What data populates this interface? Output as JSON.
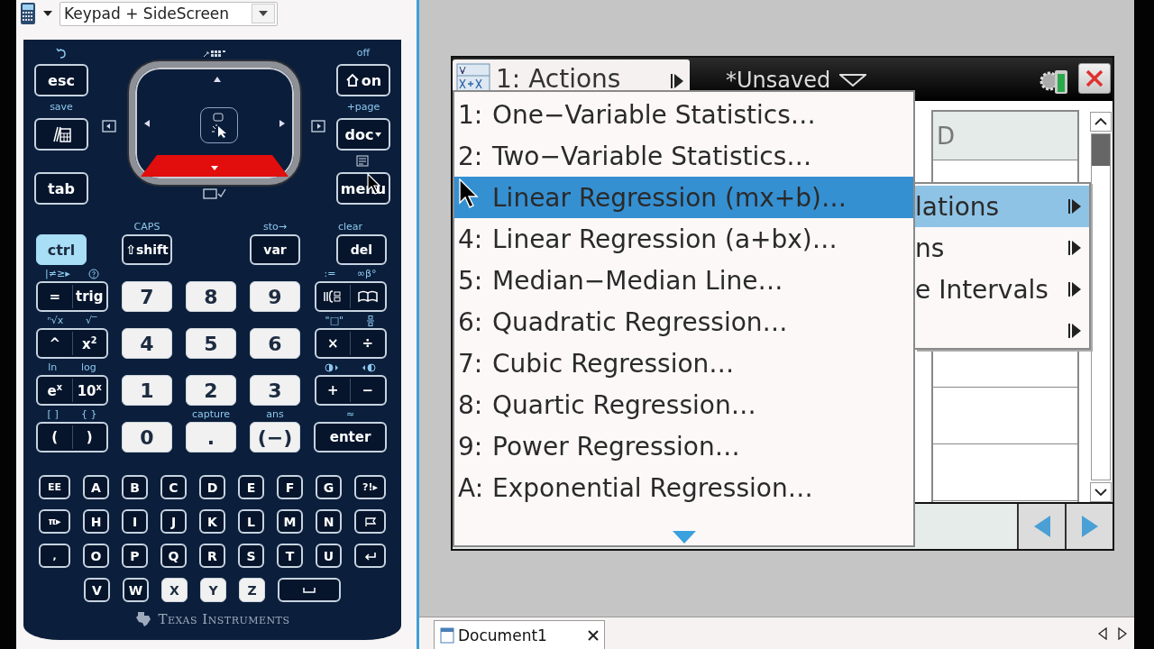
{
  "toolbar": {
    "view": "Keypad + SideScreen"
  },
  "keypad": {
    "left_keys": [
      {
        "kind": "text",
        "label": "esc"
      },
      {
        "kind": "scratchpad",
        "above": "save"
      },
      {
        "kind": "text",
        "label": "tab"
      }
    ],
    "right_keys": [
      {
        "kind": "home",
        "label": "on",
        "above": "off"
      },
      {
        "kind": "dropdown",
        "label": "doc",
        "above": "+page"
      },
      {
        "kind": "text",
        "label": "menu"
      }
    ],
    "top_row": [
      {
        "label": "ctrl",
        "on": true
      },
      {
        "label": "⇧shift",
        "above": "CAPS",
        "on": false
      },
      {
        "label": "var",
        "above": "sto→",
        "on": false
      },
      {
        "label": "del",
        "above": "clear",
        "on": false
      }
    ],
    "rows": [
      [
        {
          "kind": "pair",
          "keys": [
            {
              "kind": "text",
              "label": "=",
              "above": "|≠≥▸"
            },
            {
              "kind": "text",
              "label": "trig",
              "above": {
                "kind": "help"
              }
            }
          ]
        },
        {
          "kind": "light",
          "label": "7"
        },
        {
          "kind": "light",
          "label": "8"
        },
        {
          "kind": "light",
          "label": "9"
        },
        {
          "kind": "pair",
          "keys": [
            {
              "kind": "template",
              "above": ":="
            },
            {
              "kind": "catalog",
              "above": "∞β°"
            }
          ]
        }
      ],
      [
        {
          "kind": "pair",
          "keys": [
            {
              "kind": "text",
              "label": "^",
              "above": "ⁿ√x"
            },
            {
              "kind": "text",
              "label": "x$^{2}$",
              "above": "√‾"
            }
          ]
        },
        {
          "kind": "light",
          "label": "4"
        },
        {
          "kind": "light",
          "label": "5"
        },
        {
          "kind": "light",
          "label": "6"
        },
        {
          "kind": "pair",
          "keys": [
            {
              "kind": "text",
              "label": "×",
              "above": "\"□\""
            },
            {
              "kind": "text",
              "label": "÷",
              "above": {
                "kind": "fraction"
              }
            }
          ]
        }
      ],
      [
        {
          "kind": "pair",
          "keys": [
            {
              "kind": "text",
              "label": "e$^{x}$",
              "above": "ln"
            },
            {
              "kind": "text",
              "label": "10$^{x}$",
              "above": "log"
            }
          ]
        },
        {
          "kind": "light",
          "label": "1"
        },
        {
          "kind": "light",
          "label": "2"
        },
        {
          "kind": "light",
          "label": "3"
        },
        {
          "kind": "pair",
          "keys": [
            {
              "kind": "text",
              "label": "+",
              "above": {
                "kind": "contrast-left"
              }
            },
            {
              "kind": "text",
              "label": "−",
              "above": {
                "kind": "contrast-right"
              }
            }
          ]
        }
      ],
      [
        {
          "kind": "pair",
          "keys": [
            {
              "kind": "text",
              "label": "(",
              "above": "[ ]"
            },
            {
              "kind": "text",
              "label": ")",
              "above": "{ }"
            }
          ]
        },
        {
          "kind": "light",
          "label": "0"
        },
        {
          "kind": "light",
          "label": ".",
          "above": "capture"
        },
        {
          "kind": "light",
          "label": "(−)",
          "above": "ans"
        },
        {
          "kind": "dark",
          "label": "enter",
          "above": "≈"
        }
      ]
    ],
    "letters": [
      [
        {
          "kind": "function",
          "label": "EE"
        },
        {
          "kind": "dark",
          "label": "A"
        },
        {
          "kind": "dark",
          "label": "B"
        },
        {
          "kind": "dark",
          "label": "C"
        },
        {
          "kind": "dark",
          "label": "D"
        },
        {
          "kind": "dark",
          "label": "E"
        },
        {
          "kind": "dark",
          "label": "F"
        },
        {
          "kind": "dark",
          "label": "G"
        },
        {
          "kind": "function",
          "label": "?!▸"
        }
      ],
      [
        {
          "kind": "function",
          "label": "π▸"
        },
        {
          "kind": "dark",
          "label": "H"
        },
        {
          "kind": "dark",
          "label": "I"
        },
        {
          "kind": "dark",
          "label": "J"
        },
        {
          "kind": "dark",
          "label": "K"
        },
        {
          "kind": "dark",
          "label": "L"
        },
        {
          "kind": "dark",
          "label": "M"
        },
        {
          "kind": "dark",
          "label": "N"
        },
        {
          "kind": "flag"
        }
      ],
      [
        {
          "kind": "function",
          "label": ","
        },
        {
          "kind": "dark",
          "label": "O"
        },
        {
          "kind": "dark",
          "label": "P"
        },
        {
          "kind": "dark",
          "label": "Q"
        },
        {
          "kind": "dark",
          "label": "R"
        },
        {
          "kind": "dark",
          "label": "S"
        },
        {
          "kind": "dark",
          "label": "T"
        },
        {
          "kind": "dark",
          "label": "U"
        },
        {
          "kind": "return"
        }
      ],
      [
        {
          "kind": "dark",
          "label": "V"
        },
        {
          "kind": "dark",
          "label": "W"
        },
        {
          "kind": "light",
          "label": "X"
        },
        {
          "kind": "light",
          "label": "Y"
        },
        {
          "kind": "light",
          "label": "Z"
        },
        {
          "kind": "space"
        }
      ]
    ],
    "brand": "Texas Instruments"
  },
  "screen": {
    "app_tab": {
      "label": "1: Actions"
    },
    "document_title": "*Unsaved",
    "columns": [
      {
        "label": "D"
      }
    ],
    "menu": {
      "items": [
        {
          "number": "1:",
          "label": "One−Variable Statistics…",
          "selected": false
        },
        {
          "number": "2:",
          "label": "Two−Variable Statistics…",
          "selected": false
        },
        {
          "label": "Linear Regression (mx+b)…",
          "selected": true
        },
        {
          "number": "4:",
          "label": "Linear Regression (a+bx)…",
          "selected": false
        },
        {
          "number": "5:",
          "label": "Median−Median Line…",
          "selected": false
        },
        {
          "number": "6:",
          "label": "Quadratic Regression…",
          "selected": false
        },
        {
          "number": "7:",
          "label": "Cubic Regression…",
          "selected": false
        },
        {
          "number": "8:",
          "label": "Quartic Regression…",
          "selected": false
        },
        {
          "number": "9:",
          "label": "Power Regression…",
          "selected": false
        },
        {
          "number": "A:",
          "label": "Exponential Regression…",
          "selected": false
        }
      ]
    },
    "submenu": {
      "items": [
        {
          "label": "lations",
          "selected": true
        },
        {
          "label": "ns",
          "selected": false
        },
        {
          "label": "e Intervals",
          "selected": false
        },
        {
          "selected": false
        }
      ]
    }
  },
  "doc_tabs": [
    {
      "label": "Document1"
    }
  ]
}
